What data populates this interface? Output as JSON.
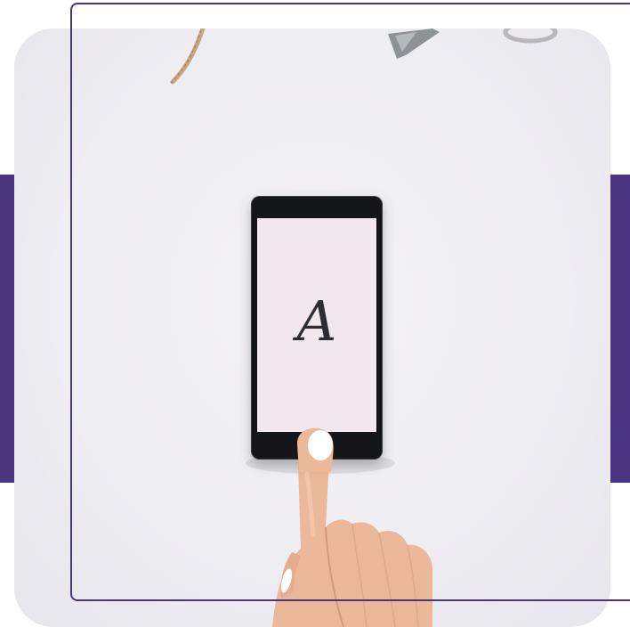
{
  "image": {
    "subject": "hand-touching-smartphone",
    "colors": {
      "accent": "#4a3680",
      "background": "#eeedf2",
      "phone_body": "#141619",
      "phone_screen": "#f1e8ee",
      "skin": "#ebb89a",
      "nail": "#ffffff"
    }
  },
  "phone": {
    "screen_glyph": "A"
  }
}
